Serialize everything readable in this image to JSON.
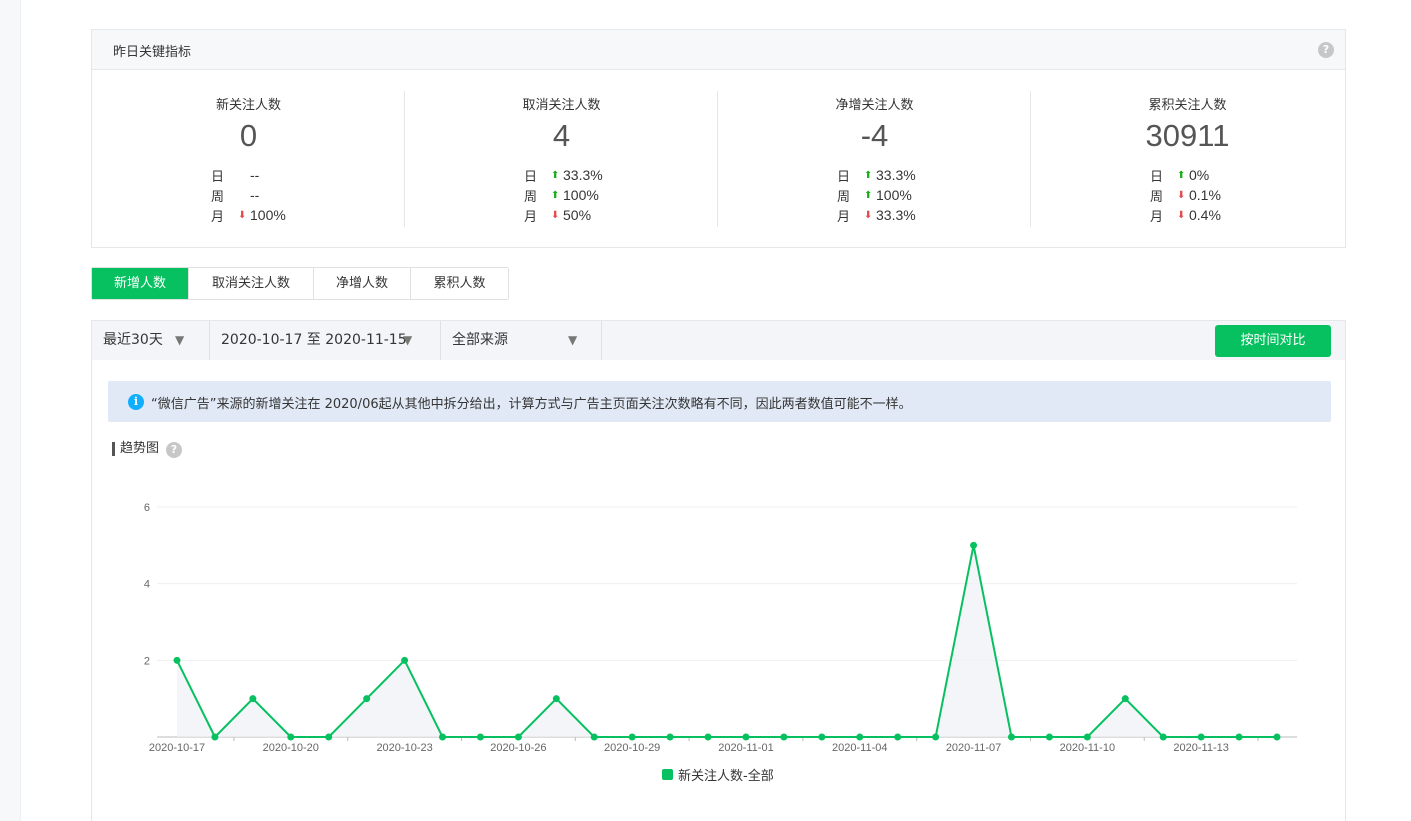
{
  "kpi": {
    "title": "昨日关键指标",
    "help": "?",
    "cards": [
      {
        "name": "新关注人数",
        "value": "0",
        "rows": [
          {
            "label": "日",
            "dir": "",
            "value": "--"
          },
          {
            "label": "周",
            "dir": "",
            "value": "--"
          },
          {
            "label": "月",
            "dir": "down",
            "value": "100%"
          }
        ]
      },
      {
        "name": "取消关注人数",
        "value": "4",
        "rows": [
          {
            "label": "日",
            "dir": "up",
            "value": "33.3%"
          },
          {
            "label": "周",
            "dir": "up",
            "value": "100%"
          },
          {
            "label": "月",
            "dir": "down",
            "value": "50%"
          }
        ]
      },
      {
        "name": "净增关注人数",
        "value": "-4",
        "rows": [
          {
            "label": "日",
            "dir": "up",
            "value": "33.3%"
          },
          {
            "label": "周",
            "dir": "up",
            "value": "100%"
          },
          {
            "label": "月",
            "dir": "down",
            "value": "33.3%"
          }
        ]
      },
      {
        "name": "累积关注人数",
        "value": "30911",
        "rows": [
          {
            "label": "日",
            "dir": "up",
            "value": "0%"
          },
          {
            "label": "周",
            "dir": "down",
            "value": "0.1%"
          },
          {
            "label": "月",
            "dir": "down",
            "value": "0.4%"
          }
        ]
      }
    ]
  },
  "tabs": [
    "新增人数",
    "取消关注人数",
    "净增人数",
    "累积人数"
  ],
  "active_tab": 0,
  "filters": {
    "range": "最近30天",
    "dates": "2020-10-17 至 2020-11-15",
    "source": "全部来源",
    "compare_button": "按时间对比"
  },
  "notice": "“微信广告”来源的新增关注在 2020/06起从其他中拆分给出，计算方式与广告主页面关注次数略有不同，因此两者数值可能不一样。",
  "trend_title": "趋势图",
  "colors": {
    "accent": "#07c160",
    "up": "#1aad19",
    "down": "#e5484d",
    "info": "#10aeff"
  },
  "chart_data": {
    "type": "line",
    "x": [
      "2020-10-17",
      "2020-10-18",
      "2020-10-19",
      "2020-10-20",
      "2020-10-21",
      "2020-10-22",
      "2020-10-23",
      "2020-10-24",
      "2020-10-25",
      "2020-10-26",
      "2020-10-27",
      "2020-10-28",
      "2020-10-29",
      "2020-10-30",
      "2020-10-31",
      "2020-11-01",
      "2020-11-02",
      "2020-11-03",
      "2020-11-04",
      "2020-11-05",
      "2020-11-06",
      "2020-11-07",
      "2020-11-08",
      "2020-11-09",
      "2020-11-10",
      "2020-11-11",
      "2020-11-12",
      "2020-11-13",
      "2020-11-14",
      "2020-11-15"
    ],
    "x_tick_labels": [
      "2020-10-17",
      "2020-10-20",
      "2020-10-23",
      "2020-10-26",
      "2020-10-29",
      "2020-11-01",
      "2020-11-04",
      "2020-11-07",
      "2020-11-10",
      "2020-11-13"
    ],
    "series": [
      {
        "name": "新关注人数-全部",
        "values": [
          2,
          0,
          1,
          0,
          0,
          1,
          2,
          0,
          0,
          0,
          1,
          0,
          0,
          0,
          0,
          0,
          0,
          0,
          0,
          0,
          0,
          5,
          0,
          0,
          0,
          1,
          0,
          0,
          0,
          0
        ]
      }
    ],
    "y_ticks": [
      2,
      4,
      6
    ],
    "ylim": [
      0,
      6
    ],
    "grid": true,
    "legend": "bottom-center"
  }
}
